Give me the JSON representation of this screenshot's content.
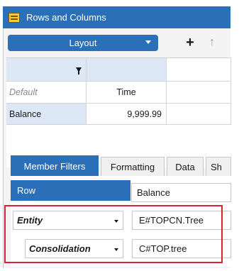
{
  "window": {
    "title": "Rows and Columns",
    "icon": "grid-table-icon"
  },
  "toolbar": {
    "layout_label": "Layout",
    "add_icon": "plus-icon",
    "up_icon": "arrow-up-icon"
  },
  "grid": {
    "default_label": "Default",
    "column_header": "Time",
    "row_header": "Balance",
    "cell_value": "9,999.99"
  },
  "tabs": [
    {
      "label": "Member Filters",
      "active": true
    },
    {
      "label": "Formatting",
      "active": false
    },
    {
      "label": "Data",
      "active": false
    },
    {
      "label": "Sh",
      "active": false
    }
  ],
  "member_filters": {
    "row_label": "Row",
    "row_value": "Balance",
    "filters": [
      {
        "dimension": "Entity",
        "value": "E#TOPCN.Tree"
      },
      {
        "dimension": "Consolidation",
        "value": "C#TOP.tree"
      }
    ]
  },
  "colors": {
    "accent": "#2b6fb8",
    "highlight": "#d9232e"
  }
}
